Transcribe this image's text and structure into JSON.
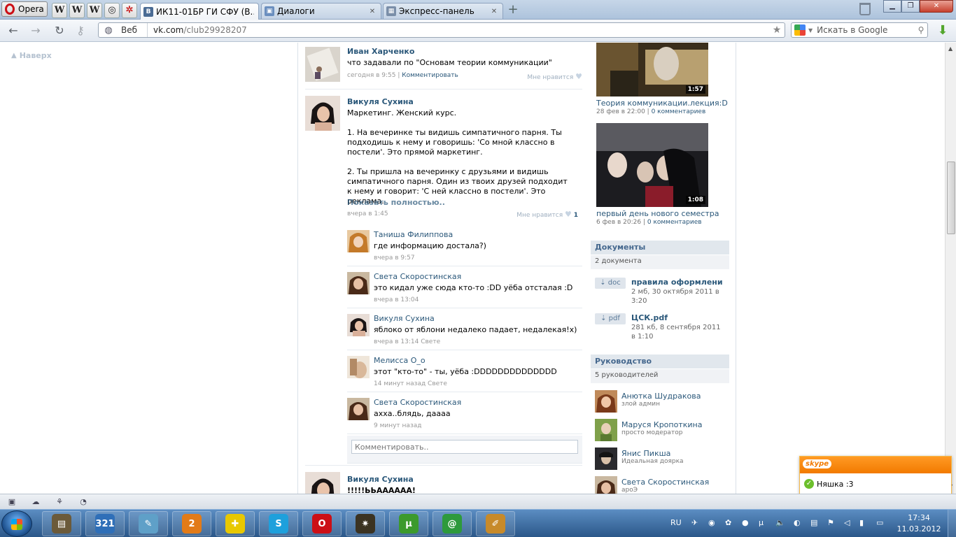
{
  "browser": {
    "menu_label": "Opera",
    "pinned_icons": [
      "W",
      "W",
      "W",
      "◎",
      "✲"
    ],
    "tabs": [
      {
        "label": "ИК11-01БР ГИ СФУ (В...",
        "icon": "В",
        "active": true
      },
      {
        "label": "Диалоги",
        "icon": "▣",
        "active": false
      },
      {
        "label": "Экспресс-панель",
        "icon": "▦",
        "active": false
      }
    ],
    "address": {
      "mode": "Веб",
      "host": "vk.com",
      "path": "/club29928207"
    },
    "search_placeholder": "Искать в Google"
  },
  "sidebar": {
    "back_to_top": "Наверх"
  },
  "posts": [
    {
      "author": "Иван Харченко",
      "text": "что задавали по \"Основам теории коммуникации\"",
      "time": "сегодня в 9:55",
      "comment_link": "Комментировать",
      "like_label": "Мне нравится",
      "like_count": ""
    },
    {
      "author": "Викуля Сухина",
      "text": "Маркетинг. Женский курс.\n\n1. На вечеринке ты видишь симпатичного парня. Ты подходишь к нему и говоришь: 'Со мной классно в постели'. Это прямой маркетинг.\n\n2. Ты пришла на вечеринку с друзьями и видишь симпатичного парня. Один из твоих друзей подходит к нему и говорит: 'С ней классно в постели'. Это реклама.",
      "show_full": "Показать полностью..",
      "time": "вчера в 1:45",
      "like_label": "Мне нравится",
      "like_count": "1"
    },
    {
      "author": "Викуля Сухина",
      "text": "!!!!!ЬЬАААААА!"
    }
  ],
  "comments": [
    {
      "name": "Таниша Филиппова",
      "text": "где информацию достала?)",
      "time": "вчера в 9:57"
    },
    {
      "name": "Света Скоростинская",
      "text": "это кидал уже сюда кто-то :DD уёба отсталая :D",
      "time": "вчера в 13:04"
    },
    {
      "name": "Викуля Сухина",
      "text": "яблоко от яблони недалеко падает, недалекая!х)",
      "time": "вчера в 13:14 Свете"
    },
    {
      "name": "Мелисса О_о",
      "text": "этот \"кто-то\" - ты, уёба :DDDDDDDDDDDDDD",
      "time": "14 минут назад Свете"
    },
    {
      "name": "Света Скоростинская",
      "text": "ахха..блядь, даааа",
      "time": "9 минут назад"
    }
  ],
  "comment_input_placeholder": "Комментировать..",
  "videos": [
    {
      "title": "Теория коммуникации.лекция:D",
      "duration": "1:57",
      "date": "28 фев в 22:00",
      "comments": "0 комментариев"
    },
    {
      "title": "первый день нового семестра",
      "duration": "1:08",
      "date": "6 фев в 20:26",
      "comments": "0 комментариев"
    }
  ],
  "documents": {
    "header": "Документы",
    "count": "2 документа",
    "items": [
      {
        "badge": "doc",
        "name": "правила оформлени..",
        "info": "2 мб, 30 октября 2011 в 3:20"
      },
      {
        "badge": "pdf",
        "name": "ЦСК.pdf",
        "info": "281 кб, 8 сентября 2011 в 1:10"
      }
    ]
  },
  "management": {
    "header": "Руководство",
    "count": "5 руководителей",
    "items": [
      {
        "name": "Анютка Шудракова",
        "role": "злой админ"
      },
      {
        "name": "Маруся Кропоткина",
        "role": "просто модератор"
      },
      {
        "name": "Янис Пикша",
        "role": "Идеальная доярка"
      },
      {
        "name": "Света Скоростинская",
        "role": "ароЭ"
      }
    ]
  },
  "skype": {
    "logo": "skype",
    "contact": "Няшка :3",
    "status": "в сети"
  },
  "taskbar": {
    "apps": [
      {
        "icon": "film-strip-icon",
        "glyph": "▤",
        "color": "#6b5a3a"
      },
      {
        "icon": "media-player-321-icon",
        "glyph": "321",
        "color": "#2f6fb8"
      },
      {
        "icon": "notepad-icon",
        "glyph": "✎",
        "color": "#5fa0c8"
      },
      {
        "icon": "qip-icon",
        "glyph": "2",
        "color": "#e27b18"
      },
      {
        "icon": "icq-plus-icon",
        "glyph": "✚",
        "color": "#e8c800"
      },
      {
        "icon": "skype-icon",
        "glyph": "S",
        "color": "#1ea0dc"
      },
      {
        "icon": "opera-icon",
        "glyph": "O",
        "color": "#cc0f16"
      },
      {
        "icon": "compass-star-icon",
        "glyph": "✷",
        "color": "#3b3322"
      },
      {
        "icon": "utorrent-icon",
        "glyph": "µ",
        "color": "#3c9a2c"
      },
      {
        "icon": "mail-agent-icon",
        "glyph": "@",
        "color": "#2e9a3c"
      },
      {
        "icon": "paint-icon",
        "glyph": "✐",
        "color": "#c78a2a"
      }
    ],
    "language": "RU",
    "time": "17:34",
    "date": "11.03.2012"
  }
}
